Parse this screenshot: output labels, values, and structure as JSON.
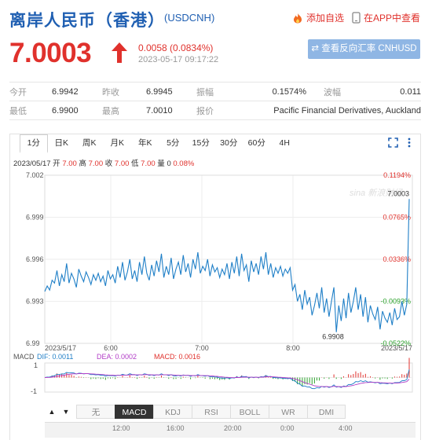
{
  "header": {
    "title": "离岸人民币（香港）",
    "code": "(USDCNH)",
    "add_fav_label": "添加自选",
    "open_app_label": "在APP中查看"
  },
  "quote": {
    "price": "7.0003",
    "change": "0.0058 (0.0834%)",
    "timestamp": "2023-05-17 09:17:22",
    "reverse_button": "⇄ 查看反向汇率 CNHUSD",
    "rows": [
      [
        {
          "label": "今开",
          "value": "6.9942"
        },
        {
          "label": "昨收",
          "value": "6.9945"
        },
        {
          "label": "振幅",
          "value": "0.1574%"
        },
        {
          "label": "波幅",
          "value": "0.011"
        }
      ],
      [
        {
          "label": "最低",
          "value": "6.9900"
        },
        {
          "label": "最高",
          "value": "7.0010"
        },
        {
          "label": "报价",
          "value": "Pacific Financial Derivatives, Auckland"
        }
      ]
    ]
  },
  "chart_tabs": [
    "1分",
    "日K",
    "周K",
    "月K",
    "年K",
    "5分",
    "15分",
    "30分",
    "60分",
    "4H"
  ],
  "active_chart_tab": "1分",
  "info_line": {
    "prefix": "2023/05/17 开 ",
    "open": "7.00",
    "high_lbl": " 高 ",
    "high": "7.00",
    "close_lbl": " 收 ",
    "close": "7.00",
    "low_lbl": " 低 ",
    "low": "7.00",
    "vol_lbl": " 量 0 ",
    "pct": "0.08%"
  },
  "watermark": "sina 新浪财经",
  "colors": {
    "up": "#e0312c",
    "down": "#2aa12a",
    "line": "#1f7fc7",
    "accent": "#1f5fb2"
  },
  "chart_data": {
    "type": "line",
    "series": [
      {
        "values": [
          6.9937,
          6.9941,
          6.9938,
          6.9945,
          6.9943,
          6.9952,
          6.9941,
          6.9949,
          6.9944,
          6.9957,
          6.9943,
          6.995,
          6.9946,
          6.994,
          6.9953,
          6.9948,
          6.9944,
          6.9951,
          6.9947,
          6.9942,
          6.9949,
          6.9945,
          6.995,
          6.9944,
          6.9948,
          6.9941,
          6.9952,
          6.9946,
          6.9949,
          6.9943,
          6.9955,
          6.9947,
          6.9958,
          6.9945,
          6.9951,
          6.996,
          6.9946,
          6.9952,
          6.9944,
          6.9958,
          6.9949,
          6.9962,
          6.995,
          6.9945,
          6.9956,
          6.9948,
          6.9959,
          6.9951,
          6.9964,
          6.9947,
          6.9955,
          6.9949,
          6.9961,
          6.9946,
          6.9953,
          6.9958,
          6.9949,
          6.9963,
          6.9951,
          6.9957,
          6.9947,
          6.996,
          6.9953,
          6.9965,
          6.995,
          6.9955,
          6.9952,
          6.996,
          6.9948,
          6.9956,
          6.9951,
          6.9954,
          6.9947,
          6.9953,
          6.9949,
          6.9957,
          6.9946,
          6.9958,
          6.995,
          6.9962,
          6.9948,
          6.9964,
          6.9952,
          6.9956,
          6.9944,
          6.9959,
          6.9951,
          6.9957,
          6.9949,
          6.9962,
          6.9953,
          6.9965,
          6.9949,
          6.9957,
          6.9947,
          6.9954,
          6.995,
          6.9955,
          6.9948,
          6.9953,
          6.995,
          6.9954,
          6.9938,
          6.9942,
          6.993,
          6.9935,
          6.9924,
          6.9938,
          6.9928,
          6.9933,
          6.992,
          6.9927,
          6.9936,
          6.9925,
          6.994,
          6.9922,
          6.9932,
          6.9919,
          6.993,
          6.994,
          6.9908,
          6.9927,
          6.9916,
          6.9932,
          6.9918,
          6.9936,
          6.9922,
          6.993,
          6.994,
          6.9924,
          6.9935,
          6.9919,
          6.9933,
          6.9915,
          6.9927,
          6.9921,
          6.9917,
          6.9926,
          6.991,
          6.9923,
          6.9918,
          6.9915,
          6.9922,
          6.9913,
          6.9925,
          6.9917,
          6.9919,
          6.993,
          6.992,
          6.9928,
          7.0003
        ]
      }
    ],
    "x_ticks": [
      "2023/5/17",
      "6:00",
      "7:00",
      "8:00",
      "2023/5/17"
    ],
    "y_ticks_left": [
      "7.002",
      "6.999",
      "6.996",
      "6.993",
      "6.99"
    ],
    "y_ticks_right": [
      "0.1194%",
      "0.0765%",
      "0.0336%",
      "-0.0093%",
      "-0.0522%"
    ],
    "ylim": [
      6.99,
      7.002
    ],
    "max_label": "7.0003",
    "min_label": "6.9908",
    "grid": true
  },
  "macd": {
    "label": "MACD",
    "dif_label": "DIF: 0.0011",
    "dea_label": "DEA: 0.0002",
    "macd_label": "MACD: 0.0016",
    "y_top": "1",
    "y_bottom": "-1"
  },
  "indicator_tabs": [
    "无",
    "MACD",
    "KDJ",
    "RSI",
    "BOLL",
    "WR",
    "DMI"
  ],
  "active_indicator": "MACD",
  "nav_labels": [
    "12:00",
    "16:00",
    "20:00",
    "0:00",
    "4:00"
  ],
  "nav_buttons": {
    "up": "▲",
    "down": "▼"
  }
}
